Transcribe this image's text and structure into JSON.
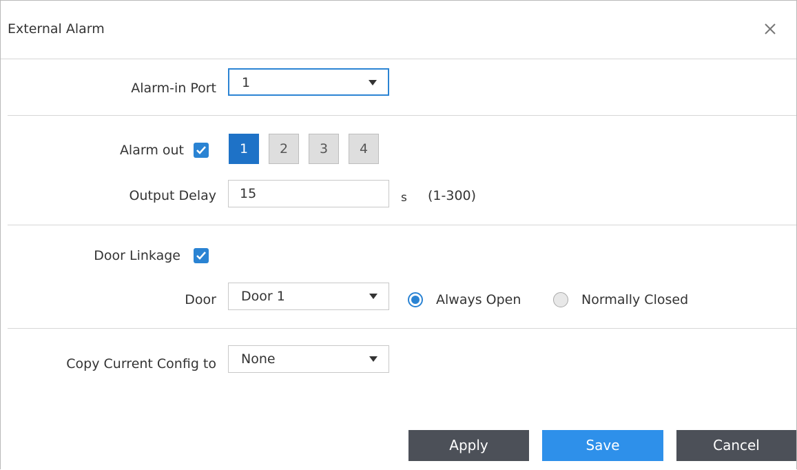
{
  "dialog": {
    "title": "External Alarm",
    "close_icon": "close-icon"
  },
  "alarm_in": {
    "label": "Alarm-in Port",
    "value": "1"
  },
  "alarm_out": {
    "label": "Alarm out",
    "checked": true,
    "ports": [
      "1",
      "2",
      "3",
      "4"
    ],
    "selected_port": "1"
  },
  "output_delay": {
    "label": "Output Delay",
    "value": "15",
    "unit": "s",
    "range": "(1-300)"
  },
  "door_linkage": {
    "label": "Door Linkage",
    "checked": true
  },
  "door": {
    "label": "Door",
    "value": "Door 1",
    "options": [
      "Always Open",
      "Normally Closed"
    ],
    "selected_option": "Always Open"
  },
  "copy_config": {
    "label": "Copy Current Config to",
    "value": "None"
  },
  "buttons": {
    "apply": "Apply",
    "save": "Save",
    "cancel": "Cancel"
  },
  "colors": {
    "accent": "#2a83d3",
    "active_port": "#1e72c7",
    "dark_button": "#4c5058",
    "save_button": "#2e90ea"
  }
}
